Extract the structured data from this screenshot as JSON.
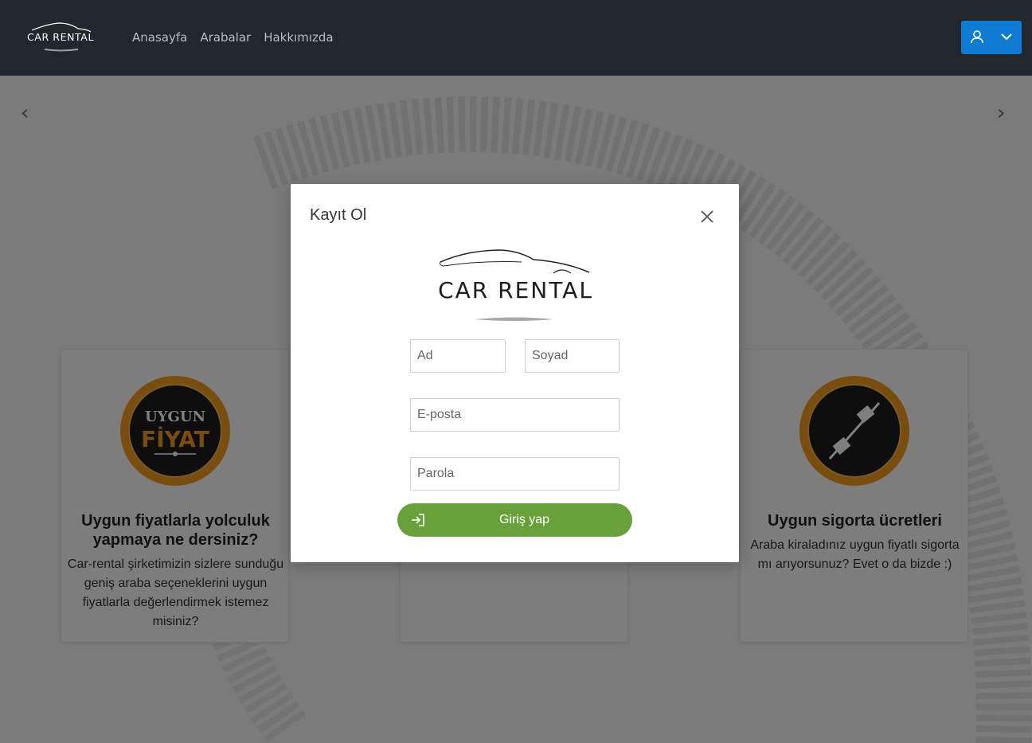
{
  "navbar": {
    "brand": "CAR RENTAL",
    "links": [
      "Anasayfa",
      "Arabalar",
      "Hakkımızda"
    ],
    "user_icon": "user-icon",
    "dropdown_icon": "chevron-down-icon",
    "accent": "#0f7bd3",
    "bg": "#22262d"
  },
  "carousel": {
    "prev_icon": "chevron-left-icon",
    "next_icon": "chevron-right-icon"
  },
  "cards": [
    {
      "badge_top": "UYGUN",
      "badge_bottom": "FİYAT",
      "title": "Uygun fiyatlarla yolculuk yapmaya ne dersiniz?",
      "text": "Car-rental şirketimizin sizlere sunduğu geniş araba seçeneklerini uygun fiyatlarla değerlendirmek istemez misiniz?"
    },
    {
      "title": "",
      "text": ""
    },
    {
      "badge_icon": "seatbelt-icon",
      "title": "Uygun sigorta ücretleri",
      "text": "Araba kiraladınız uygun fiyatlı sigorta mı arıyorsunuz? Evet o da bizde :)"
    }
  ],
  "modal": {
    "title": "Kayıt Ol",
    "logo": "CAR RENTAL",
    "fields": {
      "first_name": {
        "placeholder": "Ad"
      },
      "last_name": {
        "placeholder": "Soyad"
      },
      "email": {
        "placeholder": "E-posta"
      },
      "password": {
        "placeholder": "Parola"
      }
    },
    "submit_label": "Giriş yap",
    "submit_icon": "login-icon",
    "submit_color": "#68a139"
  }
}
